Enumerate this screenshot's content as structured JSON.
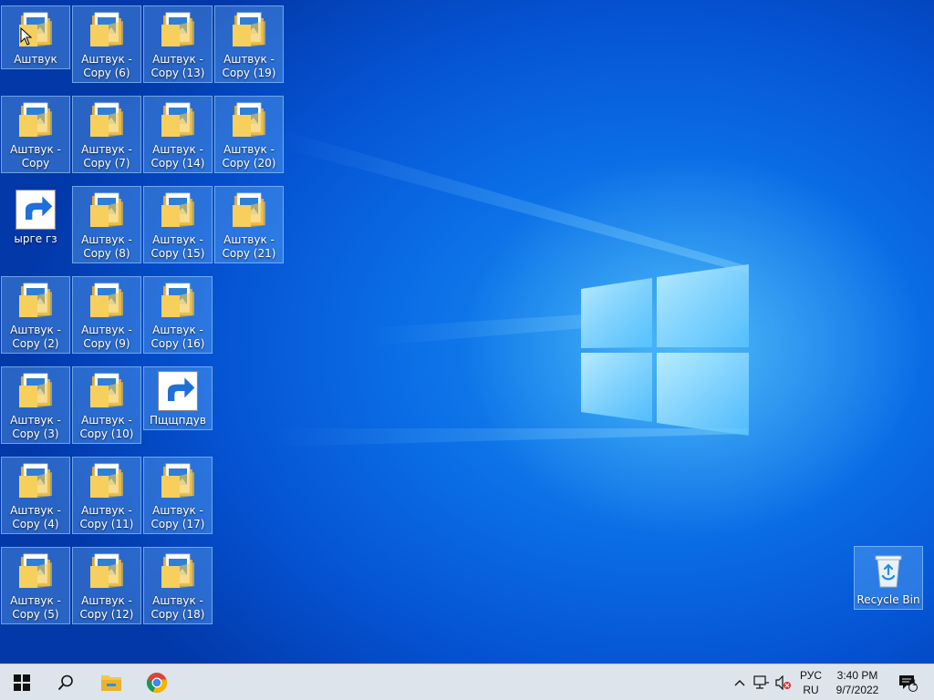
{
  "desktop": {
    "icons": [
      {
        "label": "Аштвук",
        "type": "folder"
      },
      {
        "label": "Аштвук - Copy",
        "type": "folder"
      },
      {
        "label": "ыргe гз",
        "type": "app-shortcut"
      },
      {
        "label": "Аштвук - Copy (2)",
        "type": "folder"
      },
      {
        "label": "Аштвук - Copy (3)",
        "type": "folder"
      },
      {
        "label": "Аштвук - Copy (4)",
        "type": "folder"
      },
      {
        "label": "Аштвук - Copy (5)",
        "type": "folder"
      },
      {
        "label": "Аштвук - Copy (6)",
        "type": "folder"
      },
      {
        "label": "Аштвук - Copy (7)",
        "type": "folder"
      },
      {
        "label": "Аштвук - Copy (8)",
        "type": "folder"
      },
      {
        "label": "Аштвук - Copy (9)",
        "type": "folder"
      },
      {
        "label": "Аштвук - Copy (10)",
        "type": "folder"
      },
      {
        "label": "Аштвук - Copy (11)",
        "type": "folder"
      },
      {
        "label": "Аштвук - Copy (12)",
        "type": "folder"
      },
      {
        "label": "Аштвук - Copy (13)",
        "type": "folder"
      },
      {
        "label": "Аштвук - Copy (14)",
        "type": "folder"
      },
      {
        "label": "Аштвук - Copy (15)",
        "type": "folder"
      },
      {
        "label": "Аштвук - Copy (16)",
        "type": "folder"
      },
      {
        "label": "Пщщпдув",
        "type": "chrome-shortcut"
      },
      {
        "label": "Аштвук - Copy (17)",
        "type": "folder"
      },
      {
        "label": "Аштвук - Copy (18)",
        "type": "folder"
      },
      {
        "label": "Аштвук - Copy (19)",
        "type": "folder"
      },
      {
        "label": "Аштвук - Copy (20)",
        "type": "folder"
      },
      {
        "label": "Аштвук - Copy (21)",
        "type": "folder"
      }
    ],
    "recycle_bin": {
      "label": "Recycle Bin"
    }
  },
  "taskbar": {
    "start_icon": "windows-logo-icon",
    "search_icon": "search-icon",
    "pinned": [
      "file-explorer-icon",
      "chrome-icon"
    ],
    "tray": {
      "language_top": "РУС",
      "language_bottom": "RU",
      "time": "3:40 PM",
      "date": "9/7/2022",
      "notification_count": "1"
    }
  },
  "colors": {
    "taskbar_bg": "#dde4ec",
    "desktop_accent": "#0b6ee6",
    "folder_yellow": "#f5c645"
  }
}
